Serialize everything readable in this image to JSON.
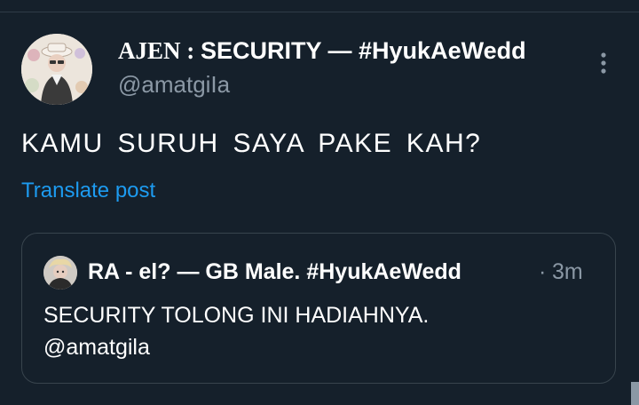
{
  "tweet": {
    "author": {
      "display_name_prefix": "AJEN : ",
      "display_name_rest": "SECURITY — #HyukAeWedd",
      "handle": "@amatgiIa",
      "avatar_icon": "profile-photo-avatar"
    },
    "more_icon": "more-vertical-icon",
    "text": "KAMU SURUH SAYA PAKE KAH?",
    "translate_label": "Translate post"
  },
  "quoted_tweet": {
    "display_name": "RA - el? — GB Male. #HyukAeWedd",
    "separator": "·",
    "time": "3m",
    "text": "SECURITY TOLONG INI HADIAHNYA.\n@amatgila",
    "avatar_icon": "profile-photo-avatar"
  },
  "colors": {
    "background": "#15202b",
    "primary_text": "#ffffff",
    "secondary_text": "#8b98a5",
    "link": "#1d9bf0",
    "border": "#38444d"
  }
}
